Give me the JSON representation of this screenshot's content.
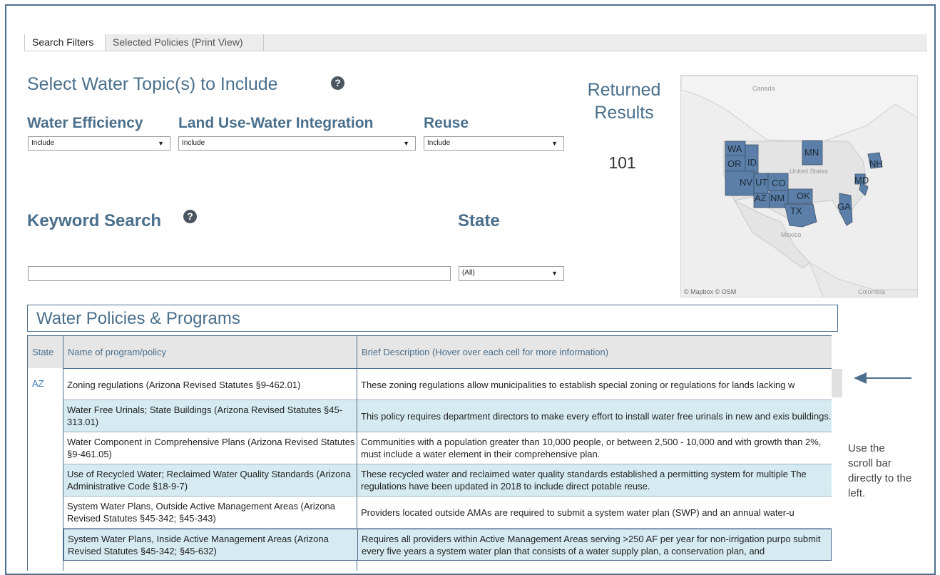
{
  "tabs": [
    {
      "label": "Search Filters",
      "active": true
    },
    {
      "label": "Selected Policies (Print View)",
      "active": false
    }
  ],
  "filters": {
    "title": "Select Water Topic(s) to Include",
    "help_icon": "question-circle",
    "water_efficiency": {
      "label": "Water Efficiency",
      "value": "Include"
    },
    "land_use": {
      "label": "Land Use-Water Integration",
      "value": "Include"
    },
    "reuse": {
      "label": "Reuse",
      "value": "Include"
    }
  },
  "keyword": {
    "label": "Keyword Search",
    "value": "",
    "placeholder": ""
  },
  "state": {
    "label": "State",
    "value": "(All)"
  },
  "results": {
    "label_line1": "Returned",
    "label_line2": "Results",
    "count": "101"
  },
  "map": {
    "attribution": "© Mapbox  © OSM",
    "labels": {
      "canada": "Canada",
      "us": "United States",
      "mexico": "Mexico",
      "colombia": "Colombia"
    },
    "states": [
      "WA",
      "OR",
      "ID",
      "NV",
      "UT",
      "CO",
      "AZ",
      "NM",
      "OK",
      "TX",
      "MN",
      "GA",
      "NH",
      "MD"
    ],
    "highlight_color": "#5b7fa8"
  },
  "table": {
    "title": "Water Policies & Programs",
    "headers": {
      "state": "State",
      "name": "Name of program/policy",
      "desc": "Brief Description (Hover over each cell for more information)"
    },
    "state_value": "AZ",
    "rows": [
      {
        "name": "Zoning regulations (Arizona Revised Statutes §9-462.01)",
        "desc": "These zoning regulations allow municipalities to establish special zoning or regulations for lands lacking w"
      },
      {
        "name": "Water Free Urinals; State Buildings (Arizona Revised Statutes §45-313.01)",
        "desc": "This policy requires department directors to make every effort to install water free urinals in new and exis buildings."
      },
      {
        "name": "Water Component in Comprehensive Plans (Arizona Revised Statutes §9-461.05)",
        "desc": "Communities with a population greater than 10,000 people, or between 2,500 - 10,000 and with growth than 2%, must include a water element in their comprehensive plan."
      },
      {
        "name": "Use of Recycled Water; Reclaimed Water Quality Standards  (Arizona Administrative Code §18-9-7)",
        "desc": "These recycled water and reclaimed water quality standards established a permitting system for multiple The regulations have been updated in 2018 to include direct potable reuse."
      },
      {
        "name": "System Water Plans, Outside Active Management Areas (Arizona Revised Statutes §45-342; §45-343)",
        "desc": "Providers located outside AMAs are required to submit a system water plan (SWP) and an annual water-u"
      },
      {
        "name": "System Water Plans, Inside Active Management Areas (Arizona Revised Statutes §45-342; §45-632)",
        "desc": "Requires all providers within Active Management Areas serving >250 AF per year for non-irrigation purpo submit every five years a system water plan that consists of a water supply plan, a conservation plan, and"
      },
      {
        "name": "",
        "desc": ""
      }
    ]
  },
  "scroll_note": "Use the scroll bar directly to the left."
}
